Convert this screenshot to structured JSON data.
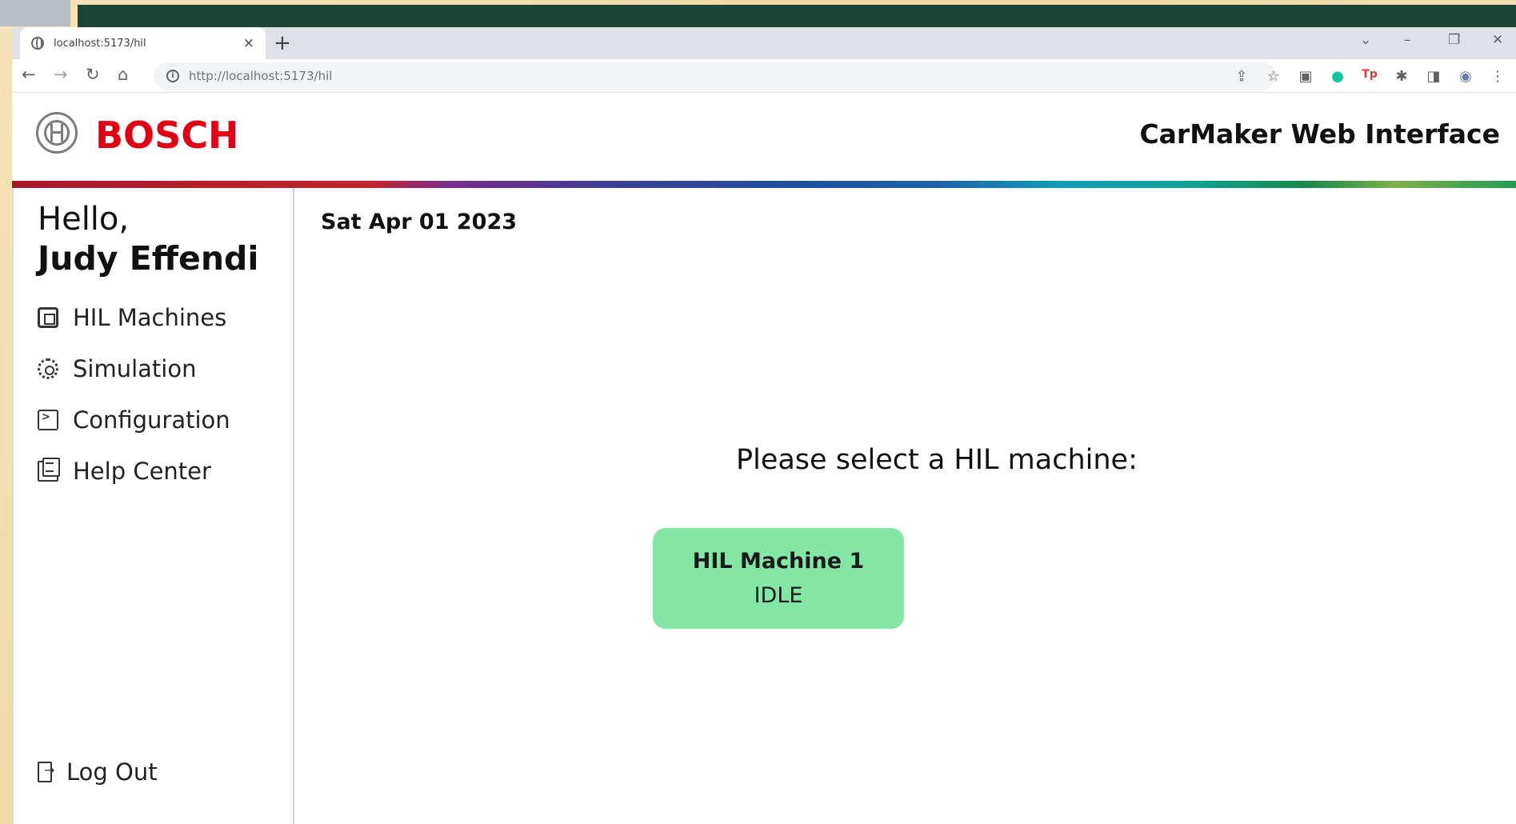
{
  "browser": {
    "tab_title": "localhost:5173/hil",
    "tab_close": "×",
    "new_tab": "+",
    "url": "http://localhost:5173/hil",
    "window_controls": [
      "⌄",
      "–",
      "❐",
      "✕"
    ],
    "toolbar_icons": [
      "share-icon",
      "star-icon",
      "extension-icon",
      "grammarly-icon",
      "tp-icon",
      "puzzle-icon",
      "sidepanel-icon",
      "profile-icon",
      "menu-icon"
    ]
  },
  "header": {
    "brand": "BOSCH",
    "title": "CarMaker Web Interface"
  },
  "sidebar": {
    "greeting": "Hello,",
    "user_name": "Judy Effendi",
    "items": [
      {
        "label": "HIL Machines",
        "icon": "chip-icon"
      },
      {
        "label": "Simulation",
        "icon": "gear-icon"
      },
      {
        "label": "Configuration",
        "icon": "terminal-icon"
      },
      {
        "label": "Help Center",
        "icon": "book-icon"
      }
    ],
    "logout_label": "Log Out"
  },
  "main": {
    "date": "Sat Apr 01 2023",
    "prompt": "Please select a HIL machine:",
    "machines": [
      {
        "name": "HIL Machine 1",
        "status": "IDLE",
        "color": "#84e6a4"
      }
    ]
  }
}
